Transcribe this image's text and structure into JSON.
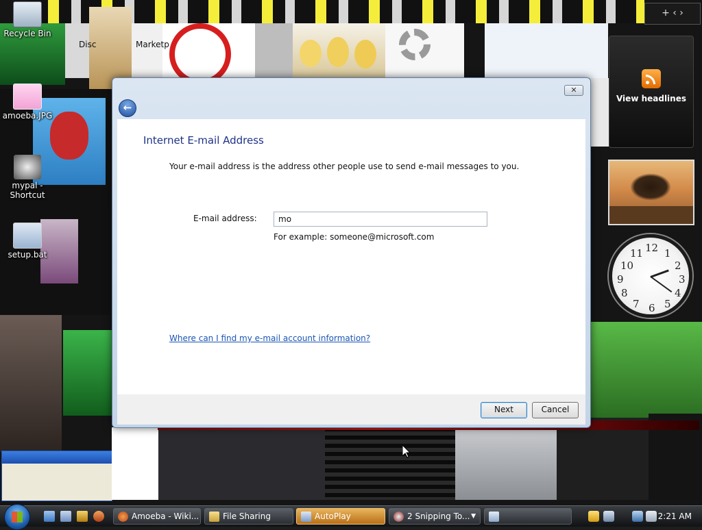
{
  "window": {
    "heading": "Internet E-mail Address",
    "description": "Your e-mail address is the address other people use to send e-mail messages to you.",
    "email_label": "E-mail address:",
    "email_value": "mo",
    "example": "For example: someone@microsoft.com",
    "help_link": "Where can I find my e-mail account information?",
    "next_label": "Next",
    "cancel_label": "Cancel"
  },
  "desktop_icons": [
    {
      "label": "Recycle Bin",
      "icon": "recycle-bin-icon"
    },
    {
      "label": "amoeba.JPG",
      "icon": "image-file-icon"
    },
    {
      "label": "mypal - Shortcut",
      "icon": "shortcut-icon"
    },
    {
      "label": "setup.bat",
      "icon": "batch-file-icon"
    }
  ],
  "gadgets": {
    "rss_label": "View headlines",
    "clock_numbers": [
      "12",
      "1",
      "2",
      "3",
      "4",
      "5",
      "6",
      "7",
      "8",
      "9",
      "10",
      "11"
    ]
  },
  "background_texts": {
    "tab_1": "Disc",
    "tab_2": "Marketp"
  },
  "taskbar": {
    "tasks": [
      {
        "label": "Amoeba - Wiki...",
        "icon": "firefox-icon"
      },
      {
        "label": "File Sharing",
        "icon": "folder-icon"
      },
      {
        "label": "AutoPlay",
        "icon": "autoplay-icon"
      },
      {
        "label": "2 Snipping To...",
        "icon": "snipping-tool-icon"
      }
    ],
    "clock": "2:21 AM"
  },
  "colors": {
    "heading": "#1e3287",
    "link": "#1a55b5",
    "active_task": "#d08a2c"
  }
}
